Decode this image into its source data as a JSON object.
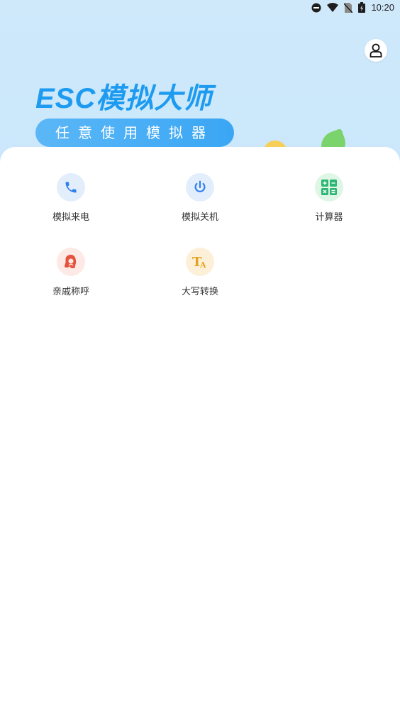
{
  "status_bar": {
    "time": "10:20"
  },
  "hero": {
    "title": "ESC模拟大师",
    "subtitle": "任意使用模拟器"
  },
  "tools": [
    {
      "label": "模拟来电",
      "icon": "phone-icon",
      "color": "#2f80ed",
      "bg": "#e3eefc"
    },
    {
      "label": "模拟关机",
      "icon": "power-icon",
      "color": "#2f80ed",
      "bg": "#e3eefc"
    },
    {
      "label": "计算器",
      "icon": "calculator-icon",
      "color": "#2bb673",
      "bg": "#dff6e6"
    },
    {
      "label": "亲戚称呼",
      "icon": "relative-icon",
      "color": "#e5533d",
      "bg": "#fdeae6"
    },
    {
      "label": "大写转换",
      "icon": "text-convert-icon",
      "color": "#e3a21a",
      "bg": "#fdf0d8"
    }
  ]
}
